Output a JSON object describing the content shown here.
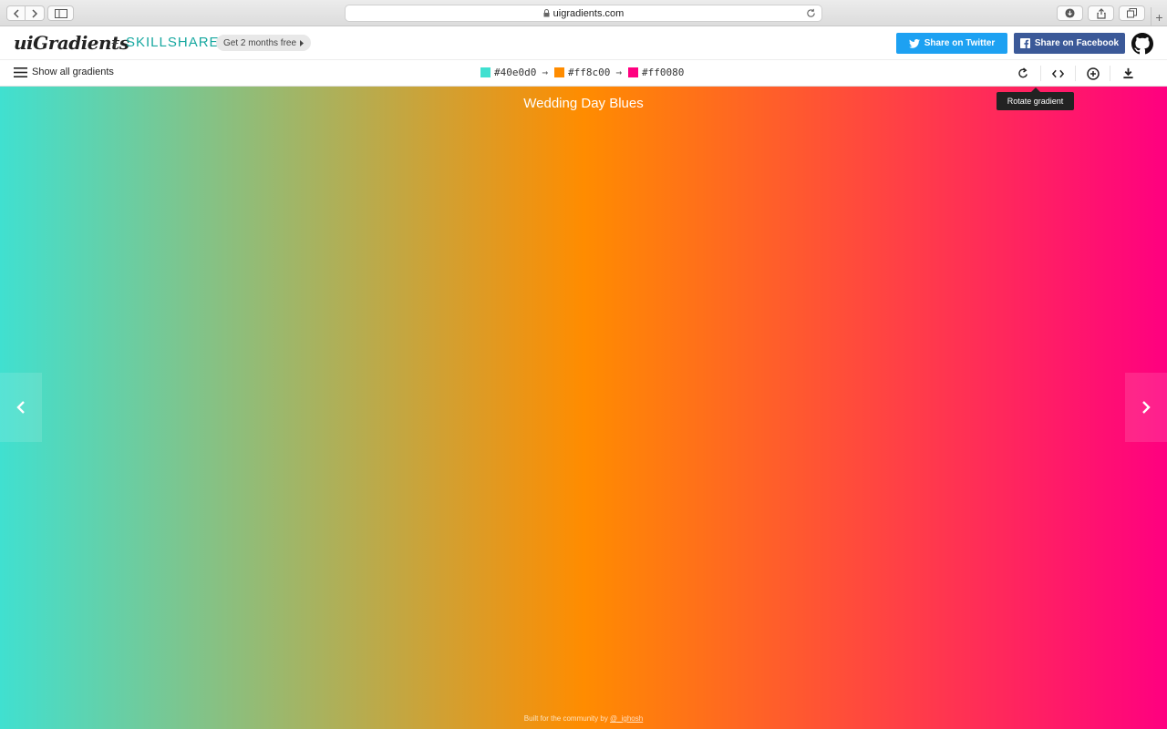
{
  "browser": {
    "url": "uigradients.com"
  },
  "header": {
    "logo": "uiGradients",
    "plus": "+",
    "partner": "SKILLSHARE",
    "promo_label": "Get 2 months free",
    "twitter_label": "Share on Twitter",
    "facebook_label": "Share on Facebook"
  },
  "toolbar": {
    "show_all_label": "Show all gradients",
    "colors": [
      {
        "hex": "#40e0d0"
      },
      {
        "hex": "#ff8c00"
      },
      {
        "hex": "#ff0080"
      }
    ],
    "tools": [
      {
        "icon": "rotate-icon"
      },
      {
        "icon": "code-icon"
      },
      {
        "icon": "add-icon"
      },
      {
        "icon": "download-icon"
      }
    ]
  },
  "tooltip": {
    "text": "Rotate gradient"
  },
  "gradient": {
    "name": "Wedding Day Blues",
    "direction": "to right"
  },
  "footer": {
    "prefix": "Built for the community by ",
    "author": "@_ighosh"
  }
}
